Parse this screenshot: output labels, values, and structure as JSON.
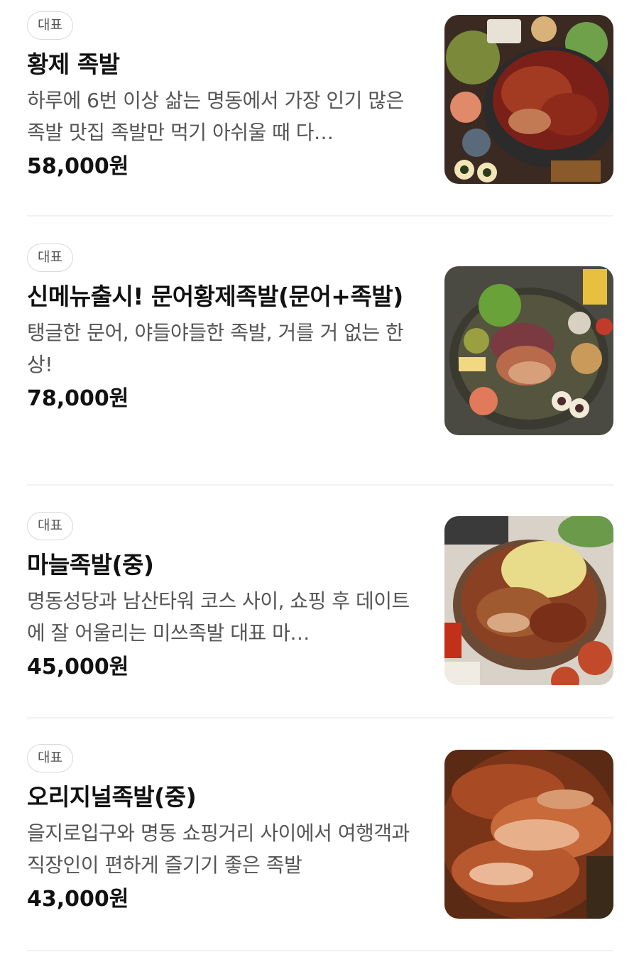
{
  "menu_items": [
    {
      "badge": "대표",
      "name": "황제 족발",
      "description": "하루에 6번 이상 삶는 명동에서 가장 인기 많은 족발 맛집 족발만 먹기 아쉬울 때 다…",
      "price": "58,000원",
      "image_icon": "jokbal-platter-photo"
    },
    {
      "badge": "대표",
      "name": "신메뉴출시! 문어황제족발(문어+족발)",
      "description": "탱글한 문어, 야들야들한 족발, 거를 거 없는 한 상!",
      "price": "78,000원",
      "image_icon": "octopus-jokbal-platter-photo"
    },
    {
      "badge": "대표",
      "name": "마늘족발(중)",
      "description": "명동성당과 남산타워 코스 사이, 쇼핑 후 데이트에 잘 어울리는 미쓰족발 대표 마…",
      "price": "45,000원",
      "image_icon": "garlic-jokbal-photo"
    },
    {
      "badge": "대표",
      "name": "오리지널족발(중)",
      "description": "을지로입구와 명동 쇼핑거리 사이에서 여행객과 직장인이 편하게 즐기기 좋은 족발",
      "price": "43,000원",
      "image_icon": "original-jokbal-photo"
    }
  ],
  "colors": {
    "text_primary": "#111111",
    "text_secondary": "#555555",
    "badge_border": "#d9d9d9",
    "divider": "#f1f1f1"
  }
}
